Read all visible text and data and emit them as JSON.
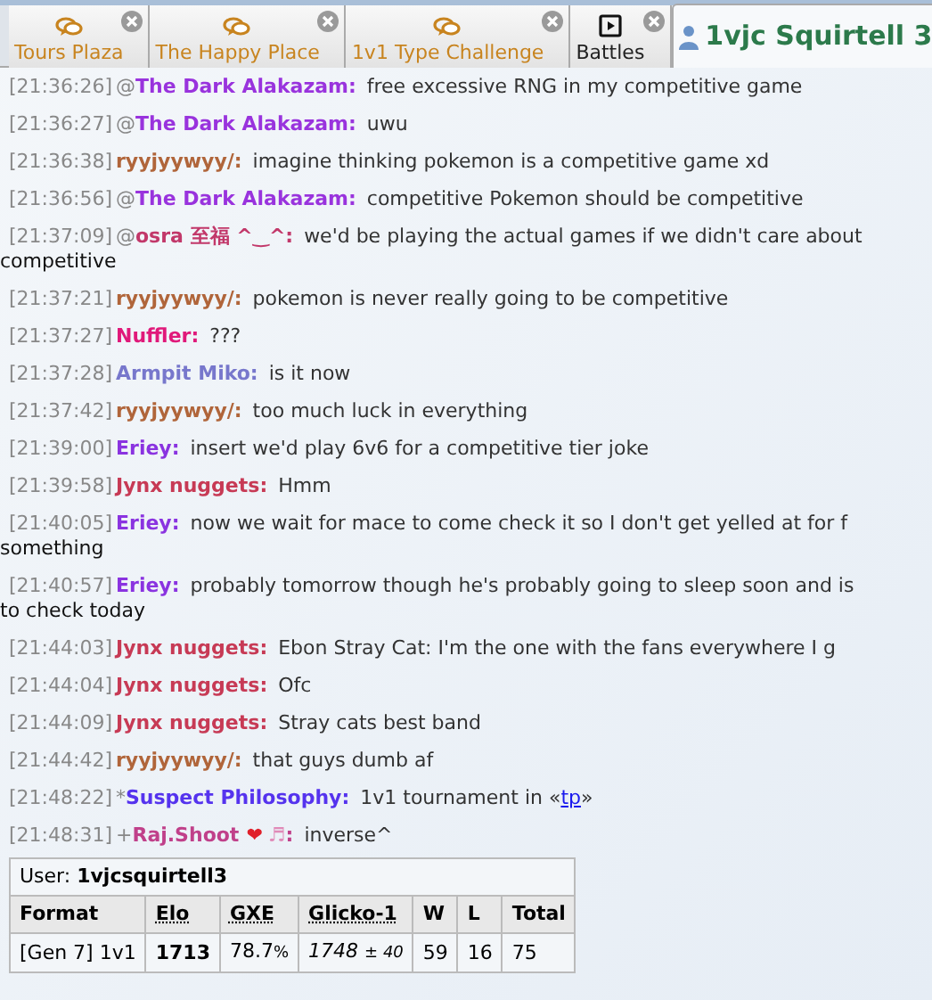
{
  "tabs": [
    {
      "label": "Tours Plaza",
      "kind": "chat",
      "selected": false
    },
    {
      "label": "The Happy Place",
      "kind": "chat",
      "selected": false
    },
    {
      "label": "1v1 Type Challenge",
      "kind": "chat",
      "selected": false
    },
    {
      "label": "Battles",
      "kind": "battles",
      "selected": false
    },
    {
      "label": "1vjc Squirtell 3",
      "kind": "user",
      "selected": true
    }
  ],
  "messages": [
    {
      "time": "[21:36:26]",
      "rank": "@",
      "name": "The Dark Alakazam:",
      "color": "#9933dd",
      "text": "free excessive RNG in my competitive game"
    },
    {
      "time": "[21:36:27]",
      "rank": "@",
      "name": "The Dark Alakazam:",
      "color": "#9933dd",
      "text": "uwu"
    },
    {
      "time": "[21:36:38]",
      "name": "ryyjyywyy/:",
      "color": "#b0653a",
      "text": "imagine thinking pokemon is a competitive game xd"
    },
    {
      "time": "[21:36:56]",
      "rank": "@",
      "name": "The Dark Alakazam:",
      "color": "#9933dd",
      "text": "competitive Pokemon should be competitive"
    },
    {
      "time": "[21:37:09]",
      "rank": "@",
      "name": "osra 至福 ^‿^:",
      "color": "#c2386a",
      "text": "we'd be playing the actual games if we didn't care about",
      "continuation": "competitive"
    },
    {
      "time": "[21:37:21]",
      "name": "ryyjyywyy/:",
      "color": "#b0653a",
      "text": "pokemon is never really going to be competitive"
    },
    {
      "time": "[21:37:27]",
      "name": "Nuffler:",
      "color": "#e0197a",
      "text": "???"
    },
    {
      "time": "[21:37:28]",
      "name": "Armpit Miko:",
      "color": "#7777cc",
      "text": "is it now"
    },
    {
      "time": "[21:37:42]",
      "name": "ryyjyywyy/:",
      "color": "#b0653a",
      "text": "too much luck in everything"
    },
    {
      "time": "[21:39:00]",
      "name": "Eriey:",
      "color": "#8a33e0",
      "text": "insert we'd play 6v6 for a competitive tier joke"
    },
    {
      "time": "[21:39:58]",
      "name": "Jynx nuggets:",
      "color": "#c73a55",
      "text": "Hmm"
    },
    {
      "time": "[21:40:05]",
      "name": "Eriey:",
      "color": "#8a33e0",
      "text": "now we wait for mace to come check it so I don't get yelled at for f",
      "continuation": "something"
    },
    {
      "time": "[21:40:57]",
      "name": "Eriey:",
      "color": "#8a33e0",
      "text": "probably tomorrow though he's probably going to sleep soon and is",
      "continuation": "to check today"
    },
    {
      "time": "[21:44:03]",
      "name": "Jynx nuggets:",
      "color": "#c73a55",
      "text": "Ebon Stray Cat: I'm the one with the fans everywhere I g"
    },
    {
      "time": "[21:44:04]",
      "name": "Jynx nuggets:",
      "color": "#c73a55",
      "text": "Ofc"
    },
    {
      "time": "[21:44:09]",
      "name": "Jynx nuggets:",
      "color": "#c73a55",
      "text": "Stray cats best band"
    },
    {
      "time": "[21:44:42]",
      "name": "ryyjyywyy/:",
      "color": "#b0653a",
      "text": "that guys dumb af"
    },
    {
      "time": "[21:48:22]",
      "rank": "*",
      "name": "Suspect Philosophy:",
      "color": "#5533ee",
      "text": "1v1 tournament in «",
      "link": "tp",
      "text_after": "»"
    },
    {
      "time": "[21:48:31]",
      "rank": "+",
      "name": "Raj.Shoot",
      "heart": "❤",
      "note": "♬",
      "suffix": ":",
      "color": "#c0408a",
      "text": "inverse^"
    }
  ],
  "ladder": {
    "user_label": "User:",
    "user": "1vjcsquirtell3",
    "columns": [
      "Format",
      "Elo",
      "GXE",
      "Glicko-1",
      "W",
      "L",
      "Total"
    ],
    "rows": [
      {
        "format": "[Gen 7] 1v1",
        "elo": "1713",
        "gxe": "78.7",
        "gxe_unit": "%",
        "glicko": "1748",
        "glicko_dev": "± 40",
        "w": "59",
        "l": "16",
        "total": "75"
      }
    ]
  }
}
